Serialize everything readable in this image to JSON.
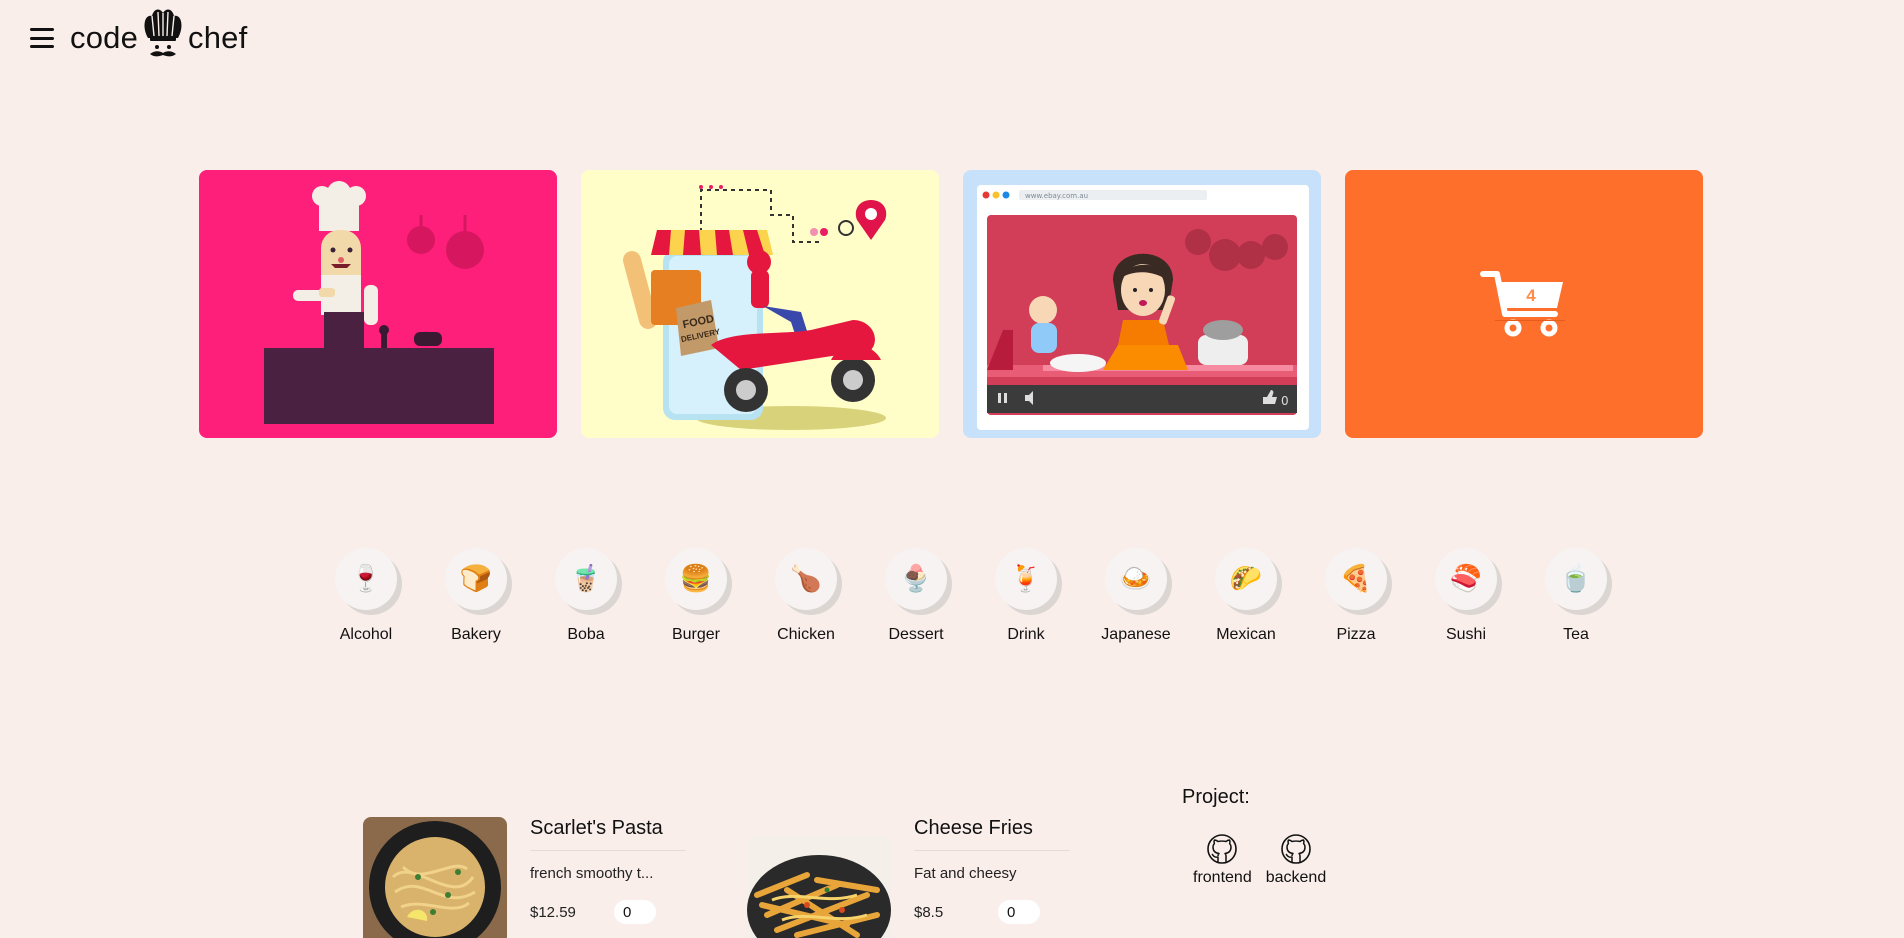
{
  "header": {
    "logo_left": "code",
    "logo_right": "chef",
    "menu_icon": "hamburger-menu-icon"
  },
  "hero": {
    "cards": [
      {
        "name": "chef-cooking-illustration"
      },
      {
        "name": "food-delivery-illustration",
        "sign_line1": "FOOD",
        "sign_line2": "DELIVERY"
      },
      {
        "name": "cooking-video-illustration",
        "url": "www.ebay.com.au",
        "likes": "0"
      },
      {
        "name": "cart",
        "count": "4"
      }
    ]
  },
  "categories": [
    {
      "label": "Alcohol",
      "icon": "🍷"
    },
    {
      "label": "Bakery",
      "icon": "🍞"
    },
    {
      "label": "Boba",
      "icon": "🧋"
    },
    {
      "label": "Burger",
      "icon": "🍔"
    },
    {
      "label": "Chicken",
      "icon": "🍗"
    },
    {
      "label": "Dessert",
      "icon": "🍨"
    },
    {
      "label": "Drink",
      "icon": "🍹"
    },
    {
      "label": "Japanese",
      "icon": "🍛"
    },
    {
      "label": "Mexican",
      "icon": "🌮"
    },
    {
      "label": "Pizza",
      "icon": "🍕"
    },
    {
      "label": "Sushi",
      "icon": "🍣"
    },
    {
      "label": "Tea",
      "icon": "🍵"
    }
  ],
  "menu_items": [
    {
      "name": "Scarlet's Pasta",
      "description": "french smoothy t...",
      "price": "$12.59",
      "quantity": "0"
    },
    {
      "name": "Cheese Fries",
      "description": "Fat and cheesy",
      "price": "$8.5",
      "quantity": "0"
    }
  ],
  "project": {
    "title": "Project:",
    "links": [
      {
        "label": "frontend",
        "icon": "github-icon"
      },
      {
        "label": "backend",
        "icon": "github-icon"
      }
    ]
  }
}
